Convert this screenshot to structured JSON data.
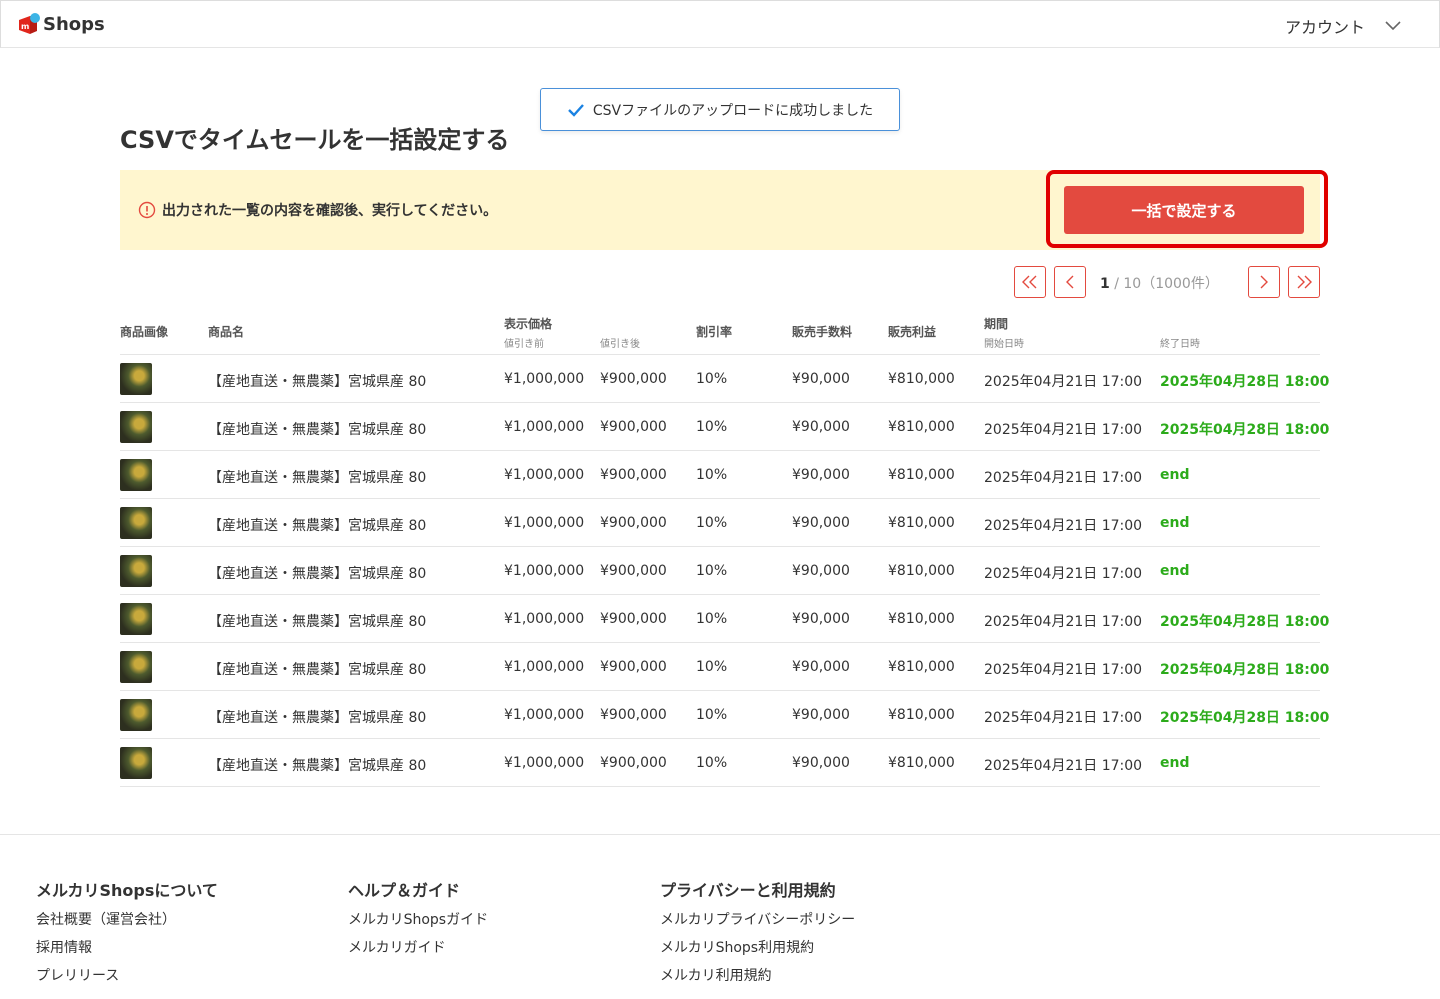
{
  "header": {
    "logo_text": "Shops",
    "account_label": "アカウント"
  },
  "toast": {
    "message": "CSVファイルのアップロードに成功しました"
  },
  "page_title": "CSVでタイムセールを一括設定する",
  "notice": {
    "message": "出力された一覧の内容を確認後、実行してください。",
    "button_label": "一括で設定する"
  },
  "pagination": {
    "current": "1",
    "separator": "/",
    "total_text": "10（1000件）"
  },
  "table": {
    "headers": {
      "image": "商品画像",
      "name": "商品名",
      "price": "表示価格",
      "price_before": "値引き前",
      "price_after": "値引き後",
      "discount": "割引率",
      "fee": "販売手数料",
      "profit": "販売利益",
      "period": "期間",
      "start": "開始日時",
      "end": "終了日時"
    },
    "rows": [
      {
        "name": "【産地直送・無農薬】宮城県産 80",
        "before": "¥1,000,000",
        "after": "¥900,000",
        "rate": "10%",
        "fee": "¥90,000",
        "profit": "¥810,000",
        "start": "2025年04月21日 17:00",
        "end": "2025年04月28日 18:00"
      },
      {
        "name": "【産地直送・無農薬】宮城県産 80",
        "before": "¥1,000,000",
        "after": "¥900,000",
        "rate": "10%",
        "fee": "¥90,000",
        "profit": "¥810,000",
        "start": "2025年04月21日 17:00",
        "end": "2025年04月28日 18:00"
      },
      {
        "name": "【産地直送・無農薬】宮城県産 80",
        "before": "¥1,000,000",
        "after": "¥900,000",
        "rate": "10%",
        "fee": "¥90,000",
        "profit": "¥810,000",
        "start": "2025年04月21日 17:00",
        "end": "end"
      },
      {
        "name": "【産地直送・無農薬】宮城県産 80",
        "before": "¥1,000,000",
        "after": "¥900,000",
        "rate": "10%",
        "fee": "¥90,000",
        "profit": "¥810,000",
        "start": "2025年04月21日 17:00",
        "end": "end"
      },
      {
        "name": "【産地直送・無農薬】宮城県産 80",
        "before": "¥1,000,000",
        "after": "¥900,000",
        "rate": "10%",
        "fee": "¥90,000",
        "profit": "¥810,000",
        "start": "2025年04月21日 17:00",
        "end": "end"
      },
      {
        "name": "【産地直送・無農薬】宮城県産 80",
        "before": "¥1,000,000",
        "after": "¥900,000",
        "rate": "10%",
        "fee": "¥90,000",
        "profit": "¥810,000",
        "start": "2025年04月21日 17:00",
        "end": "2025年04月28日 18:00"
      },
      {
        "name": "【産地直送・無農薬】宮城県産 80",
        "before": "¥1,000,000",
        "after": "¥900,000",
        "rate": "10%",
        "fee": "¥90,000",
        "profit": "¥810,000",
        "start": "2025年04月21日 17:00",
        "end": "2025年04月28日 18:00"
      },
      {
        "name": "【産地直送・無農薬】宮城県産 80",
        "before": "¥1,000,000",
        "after": "¥900,000",
        "rate": "10%",
        "fee": "¥90,000",
        "profit": "¥810,000",
        "start": "2025年04月21日 17:00",
        "end": "2025年04月28日 18:00"
      },
      {
        "name": "【産地直送・無農薬】宮城県産 80",
        "before": "¥1,000,000",
        "after": "¥900,000",
        "rate": "10%",
        "fee": "¥90,000",
        "profit": "¥810,000",
        "start": "2025年04月21日 17:00",
        "end": "end"
      }
    ]
  },
  "footer": {
    "columns": [
      {
        "title": "メルカリShopsについて",
        "links": [
          "会社概要（運営会社）",
          "採用情報",
          "プレリリース"
        ]
      },
      {
        "title": "ヘルプ＆ガイド",
        "links": [
          "メルカリShopsガイド",
          "メルカリガイド"
        ]
      },
      {
        "title": "プライバシーと利用規約",
        "links": [
          "メルカリプライバシーポリシー",
          "メルカリShops利用規約",
          "メルカリ利用規約"
        ]
      }
    ]
  },
  "colors": {
    "accent": "#e34a3f",
    "highlight": "#e00000",
    "notice_bg": "#fff6cf",
    "success_text": "#2cab1b",
    "toast_border": "#4a90d9"
  },
  "icons": [
    "mercari-logo-icon",
    "chevron-down-icon",
    "check-icon",
    "info-circle-icon",
    "double-chevron-left-icon",
    "chevron-left-icon",
    "chevron-right-icon",
    "double-chevron-right-icon"
  ]
}
